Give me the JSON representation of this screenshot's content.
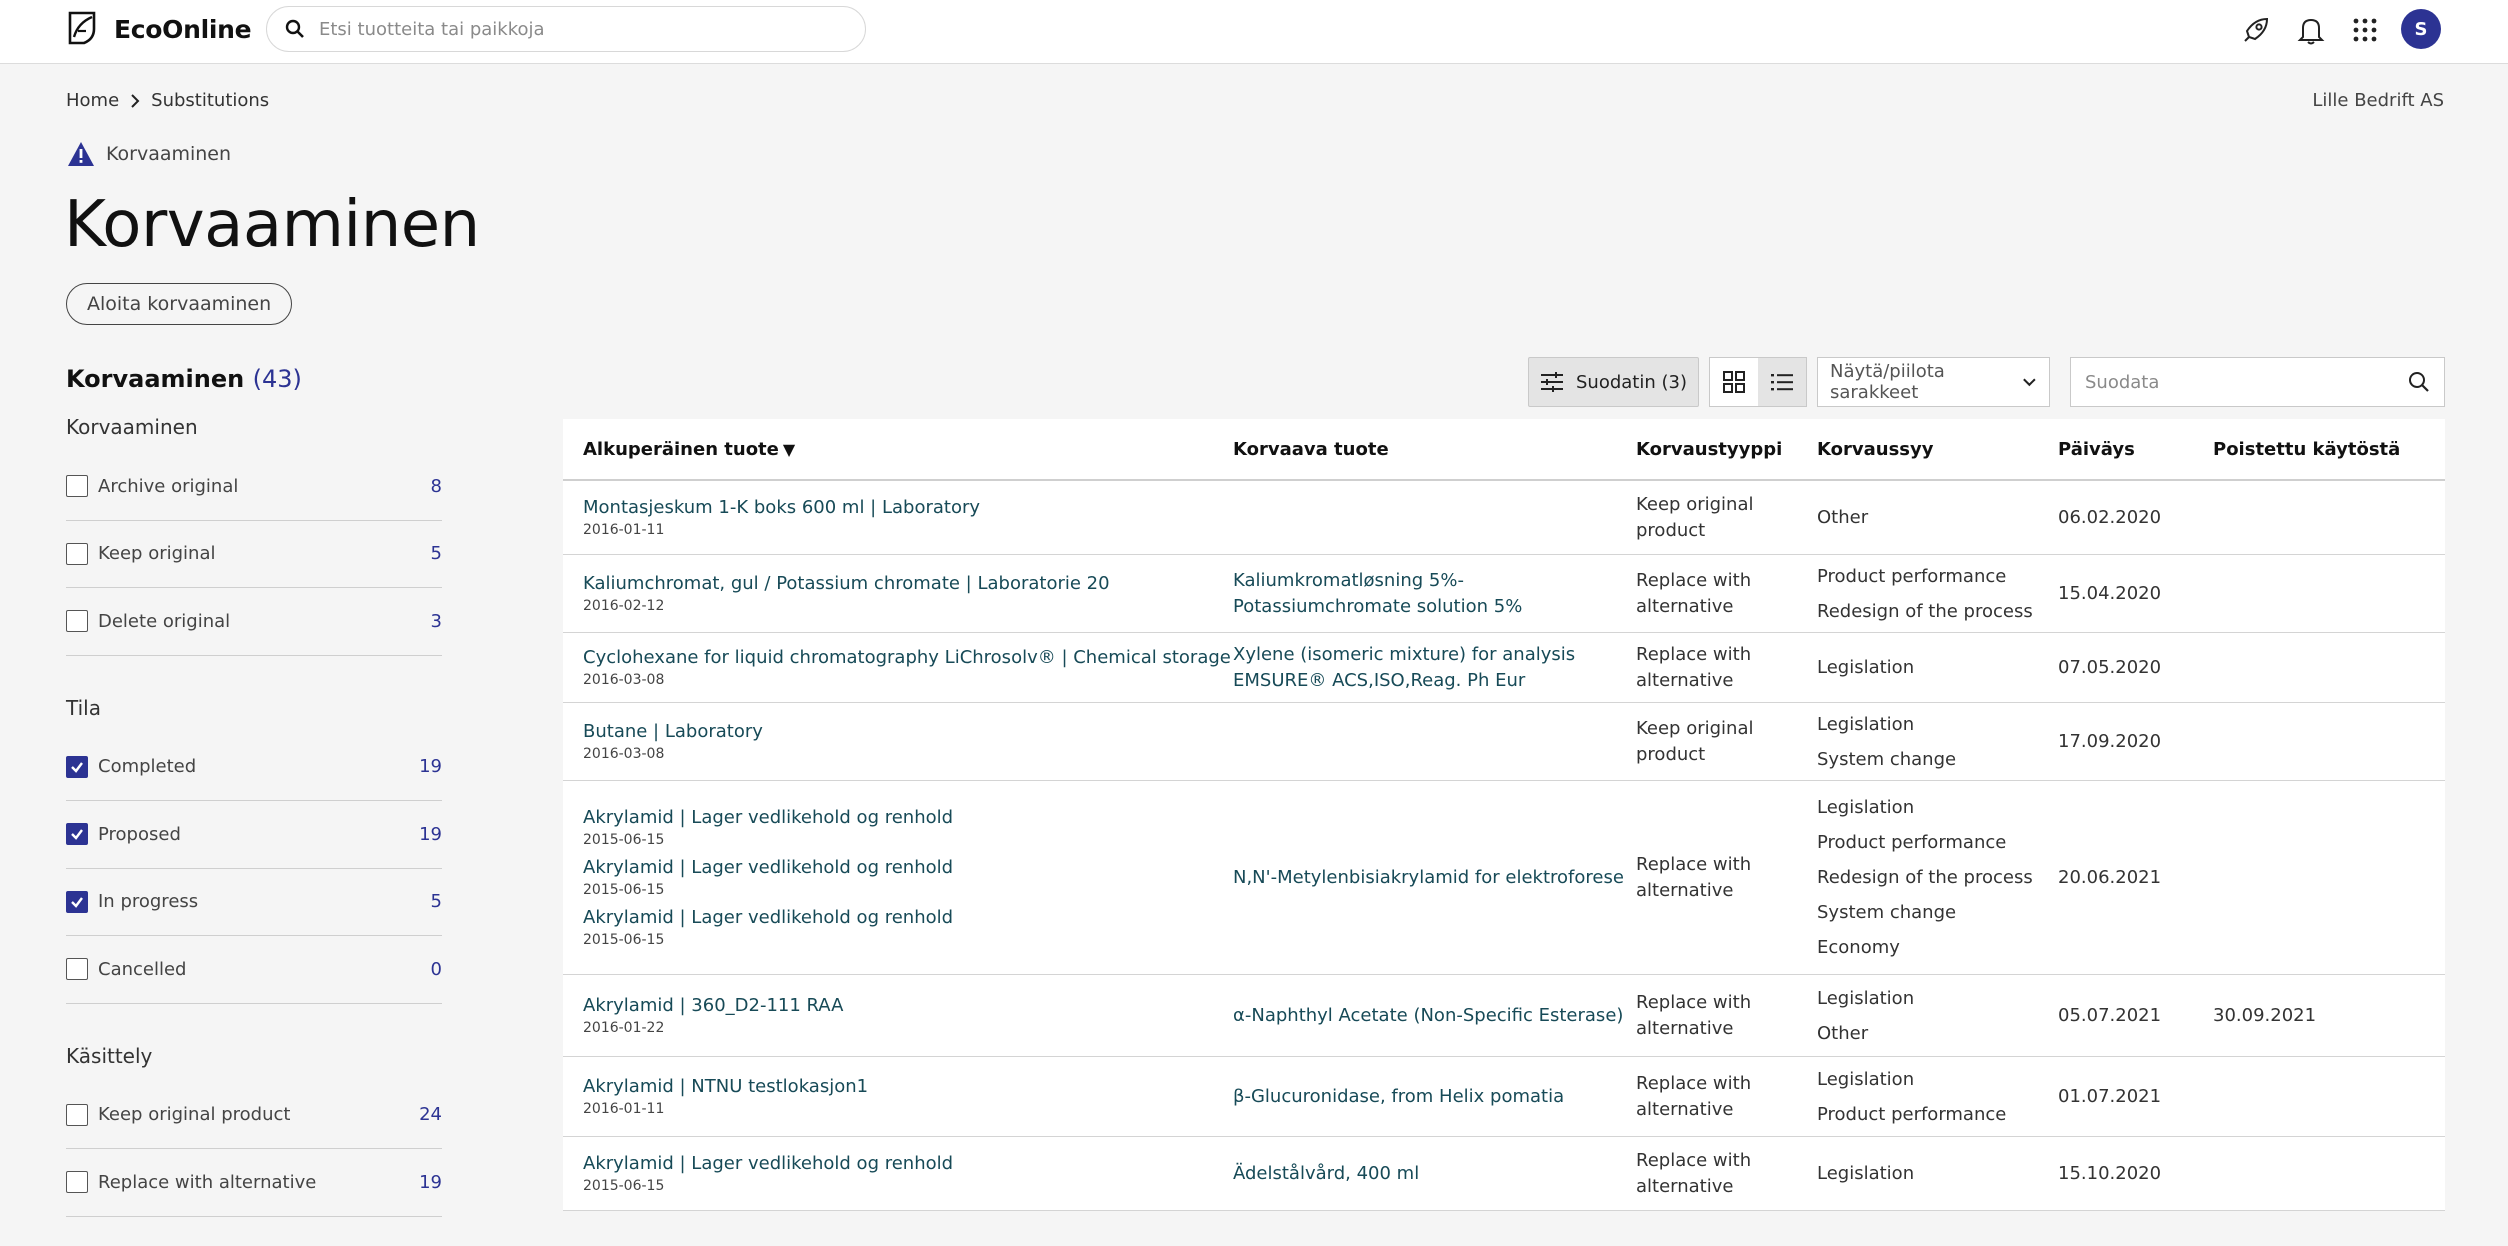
{
  "header": {
    "logo_text": "EcoOnline",
    "search_placeholder": "Etsi tuotteita tai paikkoja",
    "avatar_initial": "S",
    "icons": [
      "rocket-icon",
      "bell-icon",
      "apps-grid-icon"
    ]
  },
  "breadcrumb": {
    "home": "Home",
    "current": "Substitutions"
  },
  "company": "Lille Bedrift AS",
  "section_label": "Korvaaminen",
  "page_title": "Korvaaminen",
  "start_button": "Aloita korvaaminen",
  "facets": {
    "title": "Korvaaminen",
    "total": "(43)",
    "groups": [
      {
        "title": "Korvaaminen",
        "options": [
          {
            "label": "Archive original",
            "count": "8",
            "checked": false
          },
          {
            "label": "Keep original",
            "count": "5",
            "checked": false
          },
          {
            "label": "Delete original",
            "count": "3",
            "checked": false
          }
        ]
      },
      {
        "title": "Tila",
        "options": [
          {
            "label": "Completed",
            "count": "19",
            "checked": true
          },
          {
            "label": "Proposed",
            "count": "19",
            "checked": true
          },
          {
            "label": "In progress",
            "count": "5",
            "checked": true
          },
          {
            "label": "Cancelled",
            "count": "0",
            "checked": false
          }
        ]
      },
      {
        "title": "Käsittely",
        "options": [
          {
            "label": "Keep original product",
            "count": "24",
            "checked": false
          },
          {
            "label": "Replace with alternative",
            "count": "19",
            "checked": false
          }
        ]
      }
    ]
  },
  "toolbar": {
    "filter_button": "Suodatin (3)",
    "columns_select": "Näytä/piilota sarakkeet",
    "filter_placeholder": "Suodata"
  },
  "table": {
    "headers": [
      "Alkuperäinen tuote",
      "Korvaava tuote",
      "Korvaustyyppi",
      "Korvaussyy",
      "Päiväys",
      "Poistettu käytöstä"
    ],
    "rows": [
      {
        "originals": [
          {
            "name": "Montasjeskum 1-K boks 600 ml | Laboratory",
            "date": "2016-01-11"
          }
        ],
        "substitute": "",
        "type": "Keep original product",
        "reasons": [
          "Other"
        ],
        "date": "06.02.2020",
        "removed": ""
      },
      {
        "originals": [
          {
            "name": "Kaliumchromat, gul / Potassium chromate | Laboratorie 20",
            "date": "2016-02-12"
          }
        ],
        "substitute": "Kaliumkromatløsning 5%- Potassiumchromate solution 5%",
        "type": "Replace with alternative",
        "reasons": [
          "Product performance",
          "Redesign of the process"
        ],
        "date": "15.04.2020",
        "removed": ""
      },
      {
        "originals": [
          {
            "name": "Cyclohexane for liquid chromatography LiChrosolv® | Chemical storage",
            "date": "2016-03-08"
          }
        ],
        "substitute": "Xylene (isomeric mixture) for analysis EMSURE® ACS,ISO,Reag. Ph Eur",
        "type": "Replace with alternative",
        "reasons": [
          "Legislation"
        ],
        "date": "07.05.2020",
        "removed": ""
      },
      {
        "originals": [
          {
            "name": "Butane | Laboratory",
            "date": "2016-03-08"
          }
        ],
        "substitute": "",
        "type": "Keep original product",
        "reasons": [
          "Legislation",
          "System change"
        ],
        "date": "17.09.2020",
        "removed": ""
      },
      {
        "originals": [
          {
            "name": "Akrylamid | Lager vedlikehold og renhold",
            "date": "2015-06-15"
          },
          {
            "name": "Akrylamid | Lager vedlikehold og renhold",
            "date": "2015-06-15"
          },
          {
            "name": "Akrylamid | Lager vedlikehold og renhold",
            "date": "2015-06-15"
          }
        ],
        "substitute": "N,N'-Metylenbisiakrylamid for elektroforese",
        "type": "Replace with alternative",
        "reasons": [
          "Legislation",
          "Product performance",
          "Redesign of the process",
          "System change",
          "Economy"
        ],
        "date": "20.06.2021",
        "removed": ""
      },
      {
        "originals": [
          {
            "name": "Akrylamid | 360_D2-111 RAA",
            "date": "2016-01-22"
          }
        ],
        "substitute": "α-Naphthyl Acetate (Non-Specific Esterase)",
        "type": "Replace with alternative",
        "reasons": [
          "Legislation",
          "Other"
        ],
        "date": "05.07.2021",
        "removed": "30.09.2021"
      },
      {
        "originals": [
          {
            "name": "Akrylamid | NTNU testlokasjon1",
            "date": "2016-01-11"
          }
        ],
        "substitute": "β-Glucuronidase, from Helix pomatia",
        "type": "Replace with alternative",
        "reasons": [
          "Legislation",
          "Product performance"
        ],
        "date": "01.07.2021",
        "removed": ""
      },
      {
        "originals": [
          {
            "name": "Akrylamid | Lager vedlikehold og renhold",
            "date": "2015-06-15"
          }
        ],
        "substitute": "Ädelstålvård, 400 ml",
        "type": "Replace with alternative",
        "reasons": [
          "Legislation"
        ],
        "date": "15.10.2020",
        "removed": ""
      }
    ]
  },
  "colors": {
    "accent": "#2c3393",
    "link": "#174a57"
  }
}
